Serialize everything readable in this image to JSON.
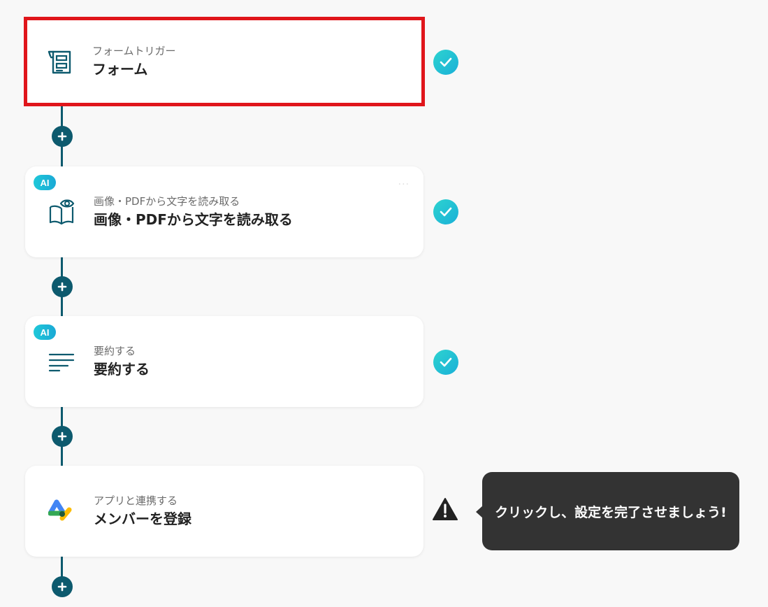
{
  "colors": {
    "accent": "#0d5a6e",
    "selected_border": "#e0161b",
    "check": "#1ab0d8",
    "tooltip_bg": "#333333",
    "ai_badge": "#1fc8d8"
  },
  "steps": [
    {
      "subtitle": "フォームトリガー",
      "title": "フォーム",
      "icon": "form-icon",
      "status": "complete",
      "selected": true
    },
    {
      "badge": "AI",
      "subtitle": "画像・PDFから文字を読み取る",
      "title": "画像・PDFから文字を読み取る",
      "icon": "book-eye-icon",
      "status": "complete",
      "more": "···"
    },
    {
      "badge": "AI",
      "subtitle": "要約する",
      "title": "要約する",
      "icon": "text-lines-icon",
      "status": "complete"
    },
    {
      "subtitle": "アプリと連携する",
      "title": "メンバーを登録",
      "icon": "google-admin-icon",
      "status": "warning"
    }
  ],
  "tooltip": {
    "text": "クリックし、設定を完了させましょう!"
  }
}
